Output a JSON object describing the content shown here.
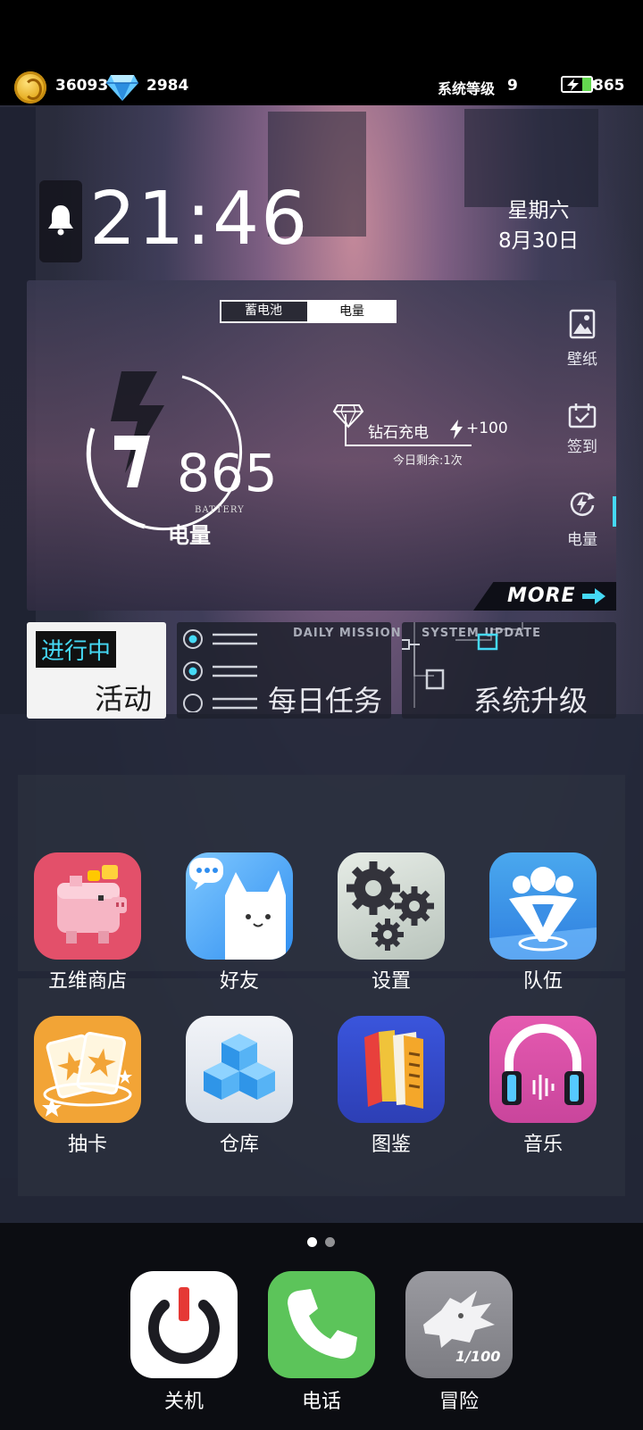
{
  "status_bar": {
    "coins": "36093",
    "diamonds": "2984",
    "system_level_label": "系统等级",
    "system_level": "9",
    "battery_value": "865"
  },
  "clock": {
    "time": "21:46",
    "weekday": "星期六",
    "date": "8月30日"
  },
  "battery_card": {
    "tab_storage": "蓄电池",
    "tab_power": "电量",
    "value": "865",
    "value_sub": "BATTERY",
    "label": "电量",
    "diamond_charge_label": "钻石充电",
    "diamond_charge_bonus": "+100",
    "remaining_today": "今日剩余:1次",
    "side_items": [
      {
        "label": "壁纸",
        "icon": "image-icon"
      },
      {
        "label": "签到",
        "icon": "checkin-icon"
      },
      {
        "label": "电量",
        "icon": "recharge-icon"
      }
    ],
    "more_label": "MORE"
  },
  "tiles": {
    "activity": {
      "badge": "进行中",
      "label": "活动"
    },
    "daily": {
      "caption": "DAILY MISSION",
      "label": "每日任务"
    },
    "system": {
      "caption": "SYSTEM UPDATE",
      "label": "系统升级"
    }
  },
  "apps_row1": [
    {
      "label": "五维商店",
      "icon": "piggy-bank-icon",
      "color": "#e3506a"
    },
    {
      "label": "好友",
      "icon": "cat-chat-icon",
      "color": "#3fa6f0"
    },
    {
      "label": "设置",
      "icon": "gear-icon",
      "color": "#cdd6cf"
    },
    {
      "label": "队伍",
      "icon": "team-icon",
      "color": "#4aa8ee"
    }
  ],
  "apps_row2": [
    {
      "label": "抽卡",
      "icon": "cards-icon",
      "color": "#f2a436"
    },
    {
      "label": "仓库",
      "icon": "cubes-icon",
      "color": "#e9edf3"
    },
    {
      "label": "图鉴",
      "icon": "books-icon",
      "color": "#3e59d8"
    },
    {
      "label": "音乐",
      "icon": "headphones-icon",
      "color": "#dc4fa8"
    }
  ],
  "page_indicator": {
    "pages": 2,
    "current": 1
  },
  "dock": [
    {
      "label": "关机",
      "icon": "power-icon",
      "color": "#ffffff"
    },
    {
      "label": "电话",
      "icon": "phone-icon",
      "color": "#5cc45a"
    },
    {
      "label": "冒险",
      "icon": "dragon-icon",
      "color": "#8e8e93",
      "badge": "1/100"
    }
  ],
  "colors": {
    "accent_cyan": "#45d9f5",
    "battery_green": "#63d94f"
  }
}
